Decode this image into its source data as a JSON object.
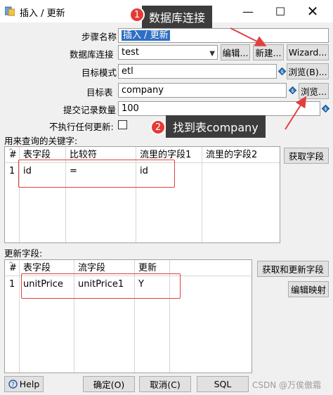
{
  "window": {
    "title": "插入 / 更新",
    "minimize_glyph": "—",
    "maximize_glyph": "☐",
    "close_glyph": "✕"
  },
  "form": {
    "step_name_label": "步骤名称",
    "step_name_value": "插入 / 更新",
    "db_connection_label": "数据库连接",
    "db_connection_value": "test",
    "edit_button": "编辑...",
    "new_button": "新建...",
    "wizard_button": "Wizard...",
    "target_schema_label": "目标模式",
    "target_schema_value": "etl",
    "browse_schema_button": "浏览(B)...",
    "target_table_label": "目标表",
    "target_table_value": "company",
    "browse_table_button": "浏览...",
    "commit_size_label": "提交记录数量",
    "commit_size_value": "100",
    "no_update_label": "不执行任何更新:",
    "no_update_checked": false
  },
  "keys_section": {
    "label": "用来查询的关键字:",
    "get_fields_button": "获取字段",
    "columns": [
      "#",
      "表字段",
      "比较符",
      "流里的字段1",
      "流里的字段2"
    ],
    "rows": [
      {
        "num": "1",
        "table_field": "id",
        "comparator": "=",
        "stream_field1": "id",
        "stream_field2": ""
      }
    ]
  },
  "update_section": {
    "label": "更新字段:",
    "get_update_fields_button": "获取和更新字段",
    "edit_mapping_button": "编辑映射",
    "columns": [
      "#",
      "表字段",
      "流字段",
      "更新"
    ],
    "rows": [
      {
        "num": "1",
        "table_field": "unitPrice",
        "stream_field": "unitPrice1",
        "update": "Y"
      }
    ]
  },
  "footer": {
    "help_button": "Help",
    "ok_button": "确定(O)",
    "cancel_button": "取消(C)",
    "sql_button": "SQL",
    "watermark": "CSDN @万俟傲霜"
  },
  "annotations": {
    "badge1": "1",
    "callout1": "数据库连接",
    "badge2": "2",
    "callout2": "找到表company",
    "highlight_color": "#e04040",
    "callout_color": "#3c3c3c"
  }
}
